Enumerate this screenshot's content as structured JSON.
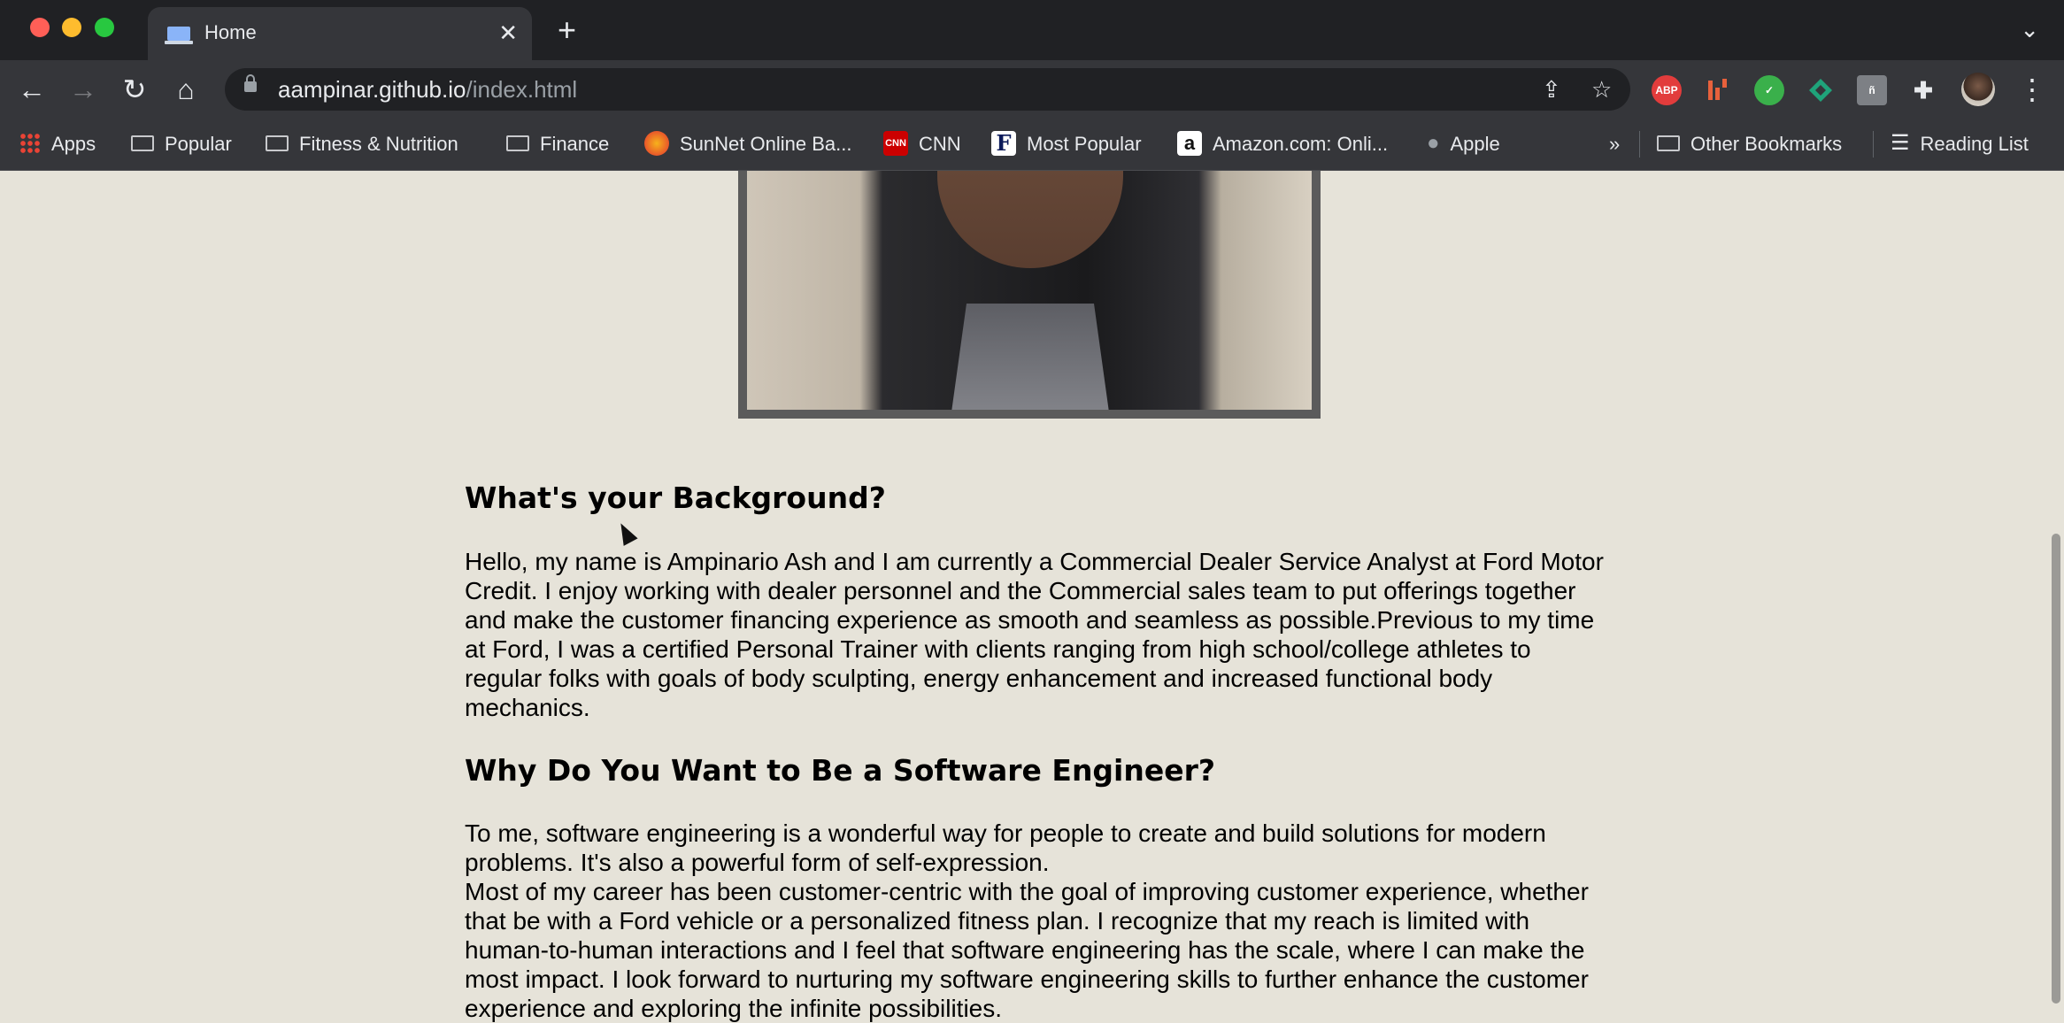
{
  "browser": {
    "tab": {
      "title": "Home"
    },
    "new_tab_icon": "plus-icon",
    "url": {
      "host": "aampinar.github.io",
      "path": "/index.html"
    },
    "bookmarks": [
      {
        "label": "Apps",
        "icon": "apps-grid-icon"
      },
      {
        "label": "Popular",
        "icon": "folder-icon"
      },
      {
        "label": "Fitness & Nutrition",
        "icon": "folder-icon"
      },
      {
        "label": "Finance",
        "icon": "folder-icon"
      },
      {
        "label": "SunNet Online Ba...",
        "icon": "sunnet-icon"
      },
      {
        "label": "CNN",
        "icon": "cnn-icon"
      },
      {
        "label": "Most Popular",
        "icon": "forbes-icon"
      },
      {
        "label": "Amazon.com: Onli...",
        "icon": "amazon-icon"
      },
      {
        "label": "Apple",
        "icon": "apple-icon"
      }
    ],
    "overflow": "»",
    "other_bookmarks": "Other Bookmarks",
    "reading_list": "Reading List",
    "extensions": [
      {
        "name": "adblock-plus-icon",
        "label": "ABP",
        "color": "#e23c3c"
      },
      {
        "name": "extension-bars-icon",
        "label": "",
        "color": "#e8613c"
      },
      {
        "name": "extension-green-icon",
        "label": "",
        "color": "#3ab04b"
      },
      {
        "name": "extension-teal-icon",
        "label": "",
        "color": "#1fa37a"
      },
      {
        "name": "extension-gray-icon",
        "label": "",
        "color": "#7d8085"
      }
    ]
  },
  "page": {
    "section1": {
      "title": "What's your Background?",
      "body": "Hello, my name is Ampinario Ash and I am currently a Commercial Dealer Service Analyst at Ford Motor Credit. I enjoy working with dealer personnel and the Commercial sales team to put offerings together and make the customer financing experience as smooth and seamless as possible.Previous to my time at Ford, I was a certified Personal Trainer with clients ranging from high school/college athletes to regular folks with goals of body sculpting, energy enhancement and increased functional body mechanics."
    },
    "section2": {
      "title": "Why Do You Want to Be a Software Engineer?",
      "body1": "To me, software engineering is a wonderful way for people to create and build solutions for modern problems. It's also a powerful form of self-expression.",
      "body2": "Most of my career has been customer-centric with the goal of improving customer experience, whether that be with a Ford vehicle or a personalized fitness plan. I recognize that my reach is limited with human-to-human interactions and I feel that software engineering has the scale, where I can make the most impact. I look forward to nurturing my software engineering skills to further enhance the customer experience and exploring the infinite possibilities."
    }
  }
}
